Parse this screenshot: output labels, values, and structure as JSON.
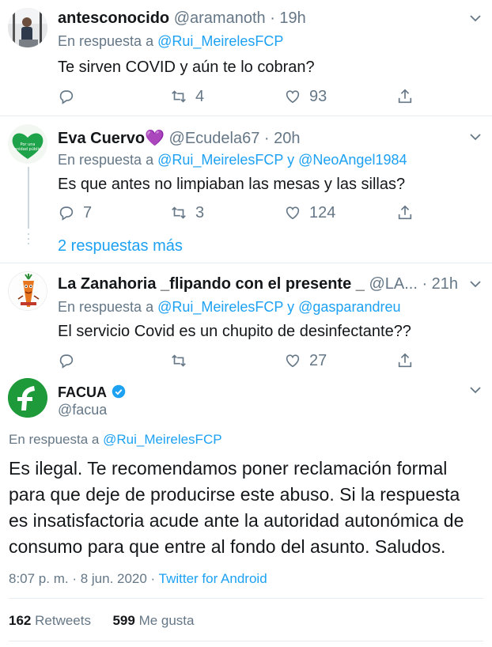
{
  "tweets": [
    {
      "name": "antesconocido",
      "handle": "@aramanoth",
      "time": "19h",
      "reply_prefix": "En respuesta a",
      "reply_to": "@Rui_MeirelesFCP",
      "text": "Te sirven COVID y aún te lo cobran?",
      "replies": "",
      "retweets": "4",
      "likes": "93"
    },
    {
      "name": "Eva Cuervo",
      "name_emoji": "💜",
      "handle": "@Ecudela67",
      "time": "20h",
      "reply_prefix": "En respuesta a",
      "reply_to_1": "@Rui_MeirelesFCP",
      "reply_joiner": "y",
      "reply_to_2": "@NeoAngel1984",
      "text": "Es que antes no limpiaban las mesas y las sillas?",
      "replies": "7",
      "retweets": "3",
      "likes": "124",
      "more_replies": "2 respuestas más"
    },
    {
      "name": "La Zanahoria _flipando con el presente _",
      "handle": "@LA...",
      "time": "21h",
      "reply_prefix": "En respuesta a",
      "reply_to_1": "@Rui_MeirelesFCP",
      "reply_joiner": "y",
      "reply_to_2": "@gasparandreu",
      "text": "El servicio Covid es un chupito de desinfectante??",
      "replies": "",
      "retweets": "",
      "likes": "27"
    }
  ],
  "main": {
    "name": "FACUA",
    "handle": "@facua",
    "reply_prefix": "En respuesta a",
    "reply_to": "@Rui_MeirelesFCP",
    "text": "Es ilegal. Te recomendamos poner reclamación formal para que deje de producirse este abuso. Si la respuesta es insatisfactoria acude ante la autoridad autonómica de consumo para que entre al fondo del asunto. Saludos.",
    "datetime": "8:07 p. m. · 8 jun. 2020 ·",
    "source": "Twitter for Android",
    "retweets_count": "162",
    "retweets_label": "Retweets",
    "likes_count": "599",
    "likes_label": "Me gusta"
  },
  "colors": {
    "accent": "#1da1f2",
    "muted": "#657786",
    "text": "#14171a",
    "verified": "#1da1f2",
    "facua_green": "#1e9a3b"
  },
  "icons": [
    "reply-icon",
    "retweet-icon",
    "like-icon",
    "share-icon",
    "chevron-down-icon",
    "verified-icon"
  ]
}
